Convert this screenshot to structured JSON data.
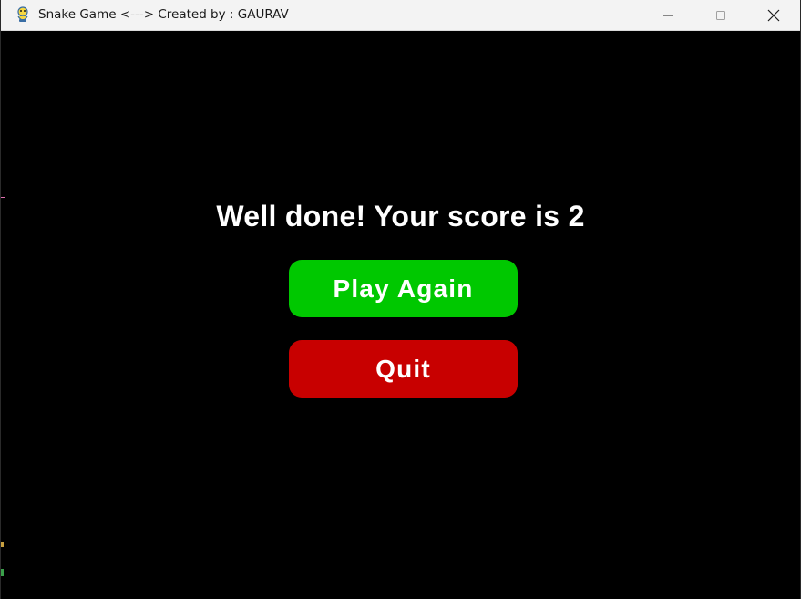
{
  "window": {
    "title": "Snake Game <---> Created by : GAURAV",
    "app_icon": "pygame-snake-icon",
    "controls": {
      "minimize": "minimize-icon",
      "maximize": "maximize-icon",
      "close": "close-icon"
    }
  },
  "game_over": {
    "message": "Well done! Your score is 2",
    "play_again_label": "Play Again",
    "quit_label": "Quit"
  },
  "colors": {
    "background": "#000000",
    "play_again": "#00c800",
    "quit": "#c80000",
    "text": "#ffffff"
  }
}
